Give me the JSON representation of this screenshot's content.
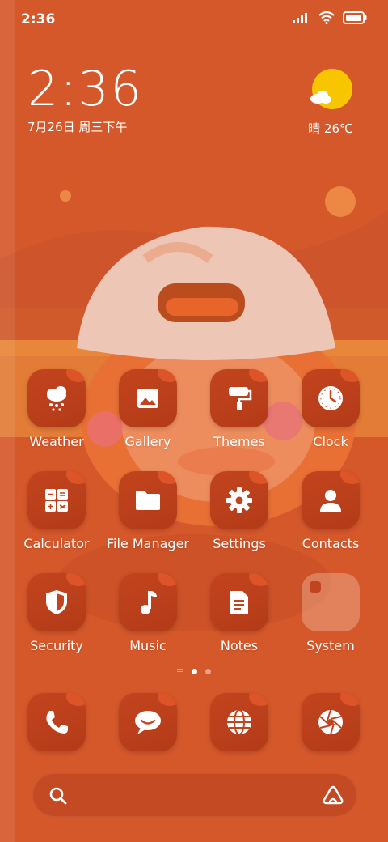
{
  "status_bar": {
    "time": "2:36"
  },
  "clock_widget": {
    "time": "2:36",
    "date": "7月26日 周三下午"
  },
  "weather_widget": {
    "text": "晴 26℃",
    "icon": "sun-cloud-icon"
  },
  "apps": [
    {
      "label": "Weather",
      "icon": "weather-snow-icon"
    },
    {
      "label": "Gallery",
      "icon": "gallery-icon"
    },
    {
      "label": "Themes",
      "icon": "paint-roller-icon"
    },
    {
      "label": "Clock",
      "icon": "clock-icon"
    },
    {
      "label": "Calculator",
      "icon": "calculator-icon"
    },
    {
      "label": "File Manager",
      "icon": "folder-icon"
    },
    {
      "label": "Settings",
      "icon": "gear-icon"
    },
    {
      "label": "Contacts",
      "icon": "person-icon"
    },
    {
      "label": "Security",
      "icon": "shield-icon"
    },
    {
      "label": "Music",
      "icon": "music-note-icon"
    },
    {
      "label": "Notes",
      "icon": "document-icon"
    },
    {
      "label": "System",
      "icon": "folder-group-icon"
    }
  ],
  "dock": [
    {
      "icon": "phone-icon"
    },
    {
      "icon": "message-icon"
    },
    {
      "icon": "globe-icon"
    },
    {
      "icon": "camera-aperture-icon"
    }
  ],
  "page_indicator": {
    "pages": 2,
    "active": 1
  },
  "colors": {
    "background": "#d45a2e",
    "icon_bg": "#c2441e",
    "accent_sun": "#f7c600"
  }
}
